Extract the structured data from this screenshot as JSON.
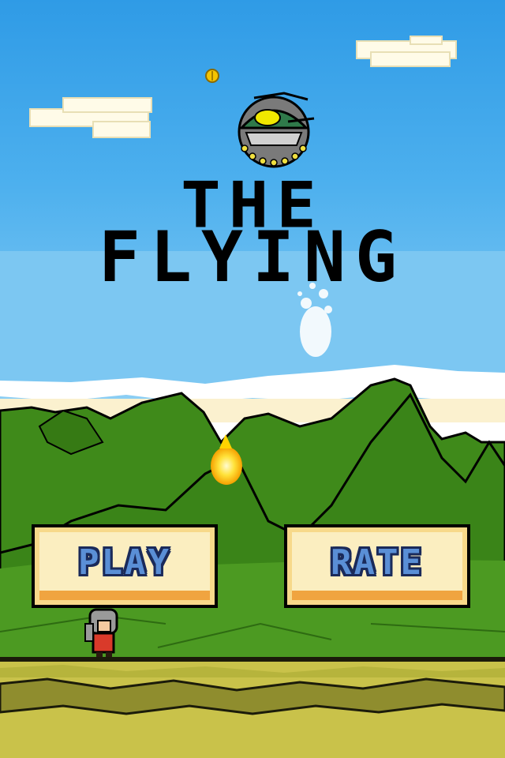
{
  "title": {
    "line1": "THE",
    "line2": "FLYING"
  },
  "buttons": {
    "play": "PLAY",
    "rate": "RATE"
  },
  "colors": {
    "sky": "#5fb8ee",
    "sky_light": "#8fd0f4",
    "cloud": "#ffffff",
    "hills": "#3f8a1a",
    "hills_dark": "#2e6b12",
    "ground": "#c9c24a",
    "ground_dark": "#8a8a2a",
    "button_face": "#fbeec0",
    "button_border": "#f0a440",
    "button_text": "#5a8fd6"
  }
}
